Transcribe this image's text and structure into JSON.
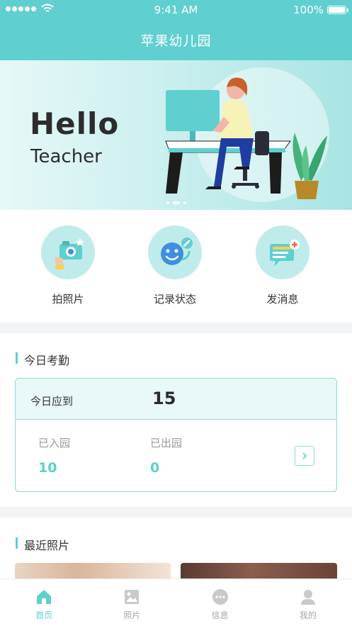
{
  "status_bar": {
    "time": "9:41 AM",
    "battery": "100%"
  },
  "header": {
    "title": "苹果幼儿园"
  },
  "banner": {
    "title": "Hello",
    "subtitle": "Teacher",
    "slides": 3,
    "active_slide": 2
  },
  "actions": [
    {
      "label": "拍照片",
      "icon": "camera-icon"
    },
    {
      "label": "记录状态",
      "icon": "smiley-edit-icon"
    },
    {
      "label": "发消息",
      "icon": "message-add-icon"
    }
  ],
  "attendance": {
    "title": "今日考勤",
    "expected_label": "今日应到",
    "expected_value": "15",
    "entered_label": "已入园",
    "entered_value": "10",
    "left_label": "已出园",
    "left_value": "0"
  },
  "photos": {
    "title": "最近照片"
  },
  "tabbar": {
    "active": 0,
    "tabs": [
      {
        "label": "首页",
        "icon": "home-icon"
      },
      {
        "label": "照片",
        "icon": "photo-icon"
      },
      {
        "label": "信息",
        "icon": "chat-icon"
      },
      {
        "label": "我的",
        "icon": "profile-icon"
      }
    ]
  },
  "colors": {
    "accent": "#5fcfd0",
    "accent_light": "#bfeceb",
    "text": "#333333",
    "muted": "#999999"
  }
}
